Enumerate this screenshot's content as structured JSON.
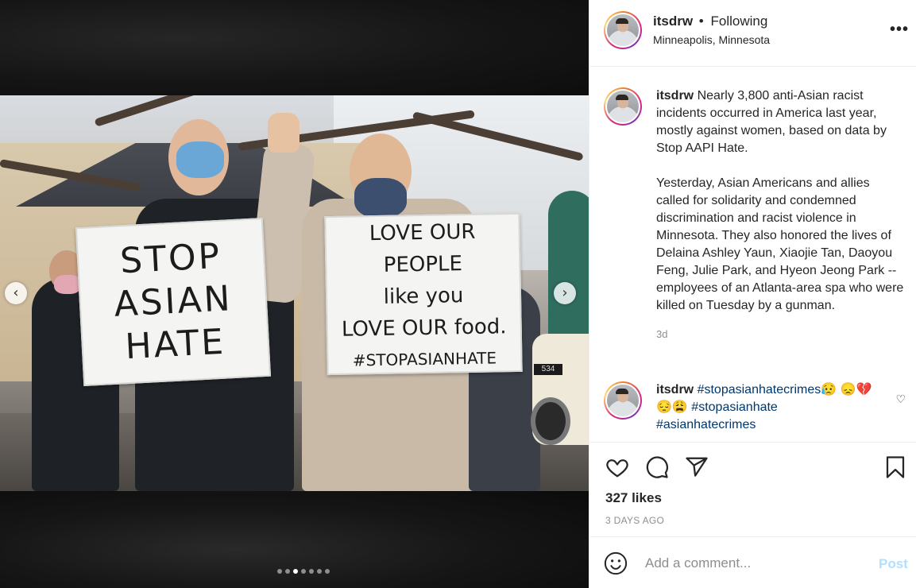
{
  "post": {
    "author": "itsdrw",
    "follow_sep": "•",
    "follow_status": "Following",
    "location": "Minneapolis, Minnesota",
    "more_label": "•••"
  },
  "media": {
    "sign_left": [
      "STOP",
      "ASIAN",
      "HATE"
    ],
    "sign_right": [
      "LOVE OUR PEOPLE",
      "like you",
      "LOVE OUR food."
    ],
    "sign_right_tag": "#STOPASIANHATE",
    "vehicle_number": "534",
    "prev_icon": "‹",
    "next_icon": "›",
    "carousel": {
      "count": 7,
      "active_index": 2
    }
  },
  "caption": {
    "author": "itsdrw",
    "text_p1": "Nearly 3,800 anti-Asian racist incidents occurred in America last year, mostly against women, based on data by Stop AAPI Hate.",
    "text_p2": "Yesterday, Asian Americans and allies called for solidarity and condemned discrimination and racist violence in Minnesota. They also honored the lives of Delaina Ashley Yaun, Xiaojie Tan, Daoyou Feng, Julie Park, and Hyeon Jeong Park -- employees of an Atlanta-area spa who were killed on Tuesday by a gunman.",
    "age": "3d"
  },
  "comment": {
    "author": "itsdrw",
    "tag1": "#stopasianhatecrimes",
    "emoji1": "😥",
    "emoji_row": "😞💔😔😩",
    "tag2": "#stopasianhate",
    "tag3": "#asianhatecrimes",
    "like_icon": "♡"
  },
  "engagement": {
    "likes": "327 likes",
    "posted": "3 DAYS AGO"
  },
  "composer": {
    "placeholder": "Add a comment...",
    "post_label": "Post"
  },
  "icons": {
    "like": "heart-icon",
    "comment": "comment-bubble-icon",
    "share": "paper-plane-icon",
    "save": "bookmark-icon",
    "emoji": "smiley-icon"
  }
}
